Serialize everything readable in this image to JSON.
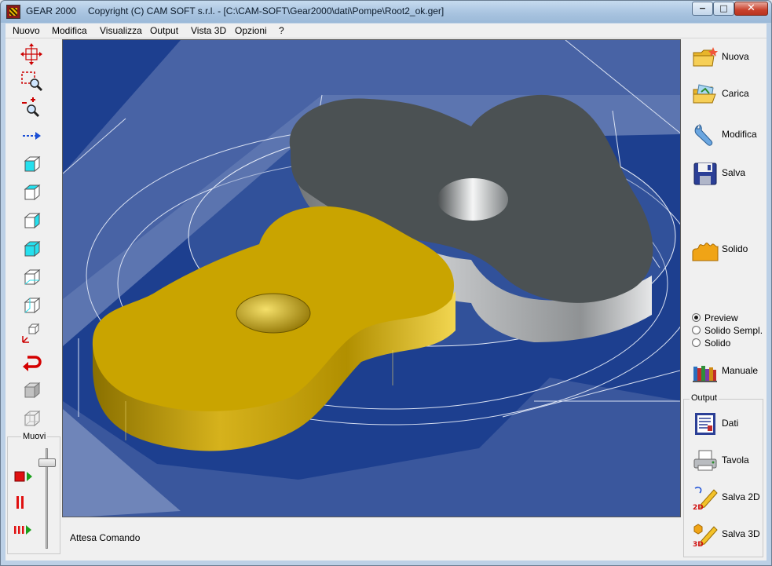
{
  "window": {
    "app_name": "GEAR 2000",
    "title": "Copyright (C)  CAM SOFT s.r.l. - [C:\\CAM-SOFT\\Gear2000\\dati\\Pompe\\Root2_ok.ger]",
    "controls": {
      "minimize": "−",
      "maximize": "□",
      "close": "✕"
    }
  },
  "menu": {
    "items": [
      "Nuovo",
      "Modifica",
      "Visualizza",
      "Output",
      "Vista 3D",
      "Opzioni",
      "?"
    ]
  },
  "left_toolbar": {
    "tools": [
      {
        "icon": "pan-icon"
      },
      {
        "icon": "zoom-window-icon"
      },
      {
        "icon": "zoom-in-out-icon"
      },
      {
        "icon": "move-arrow-icon"
      },
      {
        "icon": "view-front-cube-icon"
      },
      {
        "icon": "view-wire-cube-icon"
      },
      {
        "icon": "view-side-cube-icon"
      },
      {
        "icon": "view-top-cube-icon"
      },
      {
        "icon": "view-iso-cube-icon"
      },
      {
        "icon": "view-iso2-cube-icon"
      },
      {
        "icon": "axes-cube-icon"
      },
      {
        "icon": "rotate-back-icon"
      },
      {
        "icon": "solid-cube-icon"
      },
      {
        "icon": "wireframe-cube-icon"
      }
    ],
    "muovi": {
      "label": "Muovi",
      "controls": [
        {
          "icon": "play-icon"
        },
        {
          "icon": "pause-icon"
        },
        {
          "icon": "step-forward-icon"
        }
      ]
    }
  },
  "viewport": {
    "background": "#1d3f8f",
    "gear_gold": "#c9a400",
    "gear_gray": "#4b5153"
  },
  "status": {
    "text": "Attesa Comando"
  },
  "right_panel": {
    "buttons": [
      {
        "label": "Nuova",
        "icon": "new-folder-icon"
      },
      {
        "label": "Carica",
        "icon": "open-folder-icon"
      },
      {
        "label": "Modifica",
        "icon": "wrench-icon"
      },
      {
        "label": "Salva",
        "icon": "floppy-disk-icon"
      },
      {
        "label": "Solido",
        "icon": "solid-gear-icon"
      }
    ],
    "view_mode": {
      "options": [
        "Preview",
        "Solido Sempl.",
        "Solido"
      ],
      "selected": "Preview"
    },
    "manuale": {
      "label": "Manuale",
      "icon": "books-icon"
    },
    "output": {
      "label": "Output",
      "buttons": [
        {
          "label": "Dati",
          "icon": "report-icon"
        },
        {
          "label": "Tavola",
          "icon": "printer-icon"
        },
        {
          "label": "Salva 2D",
          "icon": "pencil-2d-icon"
        },
        {
          "label": "Salva 3D",
          "icon": "pencil-3d-icon"
        }
      ]
    }
  }
}
